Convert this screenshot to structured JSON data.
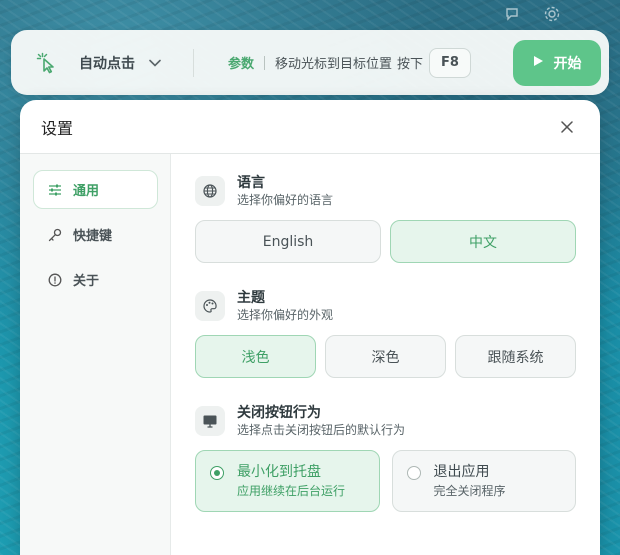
{
  "colors": {
    "accent": "#5ec58a",
    "accent_text": "#3fa066",
    "active_bg": "#e6f5ec"
  },
  "toolbar": {
    "mode_label": "自动点击",
    "params_label": "参数",
    "instruction": "移动光标到目标位置",
    "press_text": "按下",
    "hotkey": "F8",
    "start_label": "开始"
  },
  "dialog": {
    "title": "设置",
    "sidebar": {
      "items": [
        {
          "label": "通用",
          "icon": "sliders-icon",
          "active": true
        },
        {
          "label": "快捷键",
          "icon": "key-icon",
          "active": false
        },
        {
          "label": "关于",
          "icon": "info-icon",
          "active": false
        }
      ]
    },
    "language": {
      "title": "语言",
      "subtitle": "选择你偏好的语言",
      "options": [
        "English",
        "中文"
      ],
      "selected": "中文"
    },
    "theme": {
      "title": "主题",
      "subtitle": "选择你偏好的外观",
      "options": [
        "浅色",
        "深色",
        "跟随系统"
      ],
      "selected": "浅色"
    },
    "close_behavior": {
      "title": "关闭按钮行为",
      "subtitle": "选择点击关闭按钮后的默认行为",
      "options": [
        {
          "title": "最小化到托盘",
          "subtitle": "应用继续在后台运行",
          "selected": true
        },
        {
          "title": "退出应用",
          "subtitle": "完全关闭程序",
          "selected": false
        }
      ]
    }
  }
}
